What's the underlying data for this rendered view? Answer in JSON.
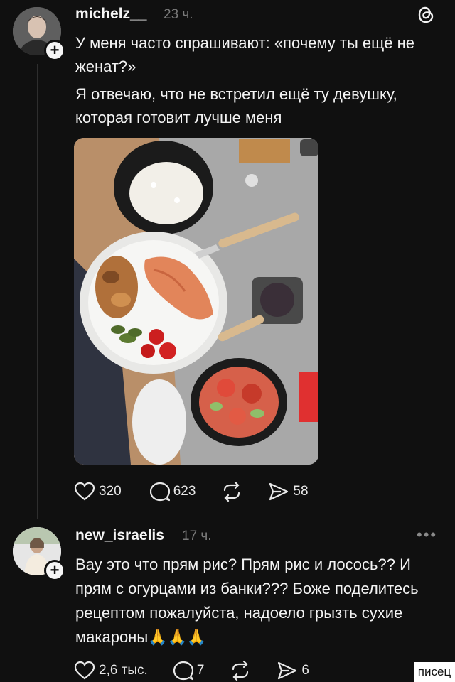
{
  "post": {
    "username": "michelz__",
    "time": "23 ч.",
    "paragraph1": "У меня часто спрашивают: «почему ты ещё не женат?»",
    "paragraph2": "Я отвечаю, что не встретил ещё ту девушку, которая готовит лучше меня",
    "likes": "320",
    "comments": "623",
    "shares": "58"
  },
  "reply": {
    "username": "new_israelis",
    "time": "17 ч.",
    "text": "Вау это что прям рис? Прям рис и лосось?? И прям с огурцами из банки??? Боже поделитесь рецептом пожалуйста, надоело грызть сухие макароны🙏🙏🙏",
    "likes": "2,6 тыс.",
    "comments": "7",
    "shares": "6"
  },
  "watermark": "писец",
  "icons": [
    "threads-logo-icon",
    "heart-icon",
    "comment-icon",
    "repost-icon",
    "share-icon",
    "more-icon",
    "plus-icon"
  ]
}
